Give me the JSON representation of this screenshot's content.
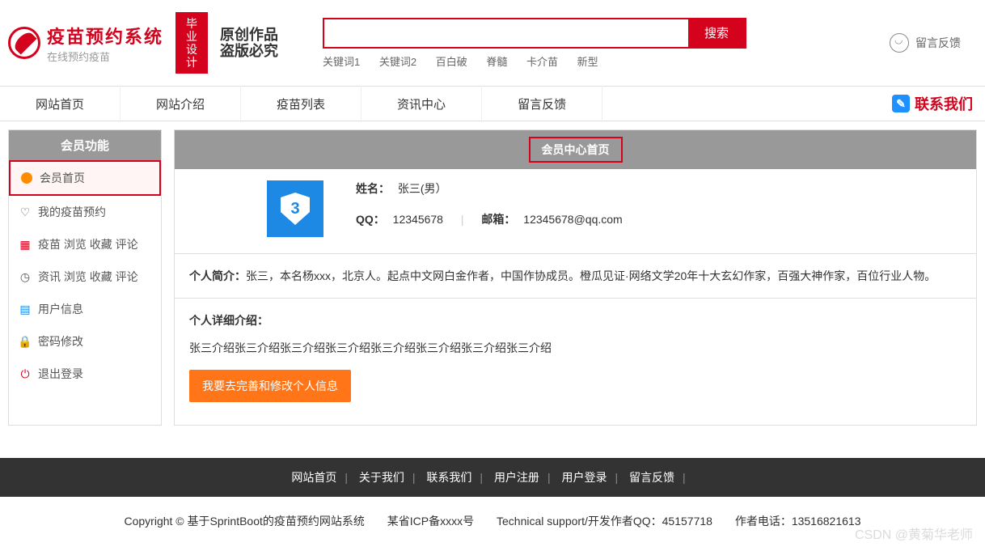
{
  "header": {
    "site_title": "疫苗预约系统",
    "site_subtitle": "在线预约疫苗",
    "badge": "毕业\n设计",
    "art_text": "原创作品\n盗版必究",
    "search_btn": "搜索",
    "keywords": [
      "关键词1",
      "关键词2",
      "百白破",
      "脊髓",
      "卡介苗",
      "新型"
    ],
    "feedback": "留言反馈"
  },
  "nav": {
    "items": [
      "网站首页",
      "网站介绍",
      "疫苗列表",
      "资讯中心",
      "留言反馈"
    ],
    "contact": "联系我们"
  },
  "sidebar": {
    "title": "会员功能",
    "items": [
      {
        "label": "会员首页",
        "active": true
      },
      {
        "label": "我的疫苗预约"
      },
      {
        "label": "疫苗 浏览 收藏 评论"
      },
      {
        "label": "资讯 浏览 收藏 评论"
      },
      {
        "label": "用户信息"
      },
      {
        "label": "密码修改"
      },
      {
        "label": "退出登录"
      }
    ]
  },
  "content": {
    "title": "会员中心首页",
    "name_label": "姓名：",
    "name_value": "张三(男）",
    "qq_label": "QQ：",
    "qq_value": "12345678",
    "email_label": "邮箱：",
    "email_value": "12345678@qq.com",
    "intro_label": "个人简介：",
    "intro_text": "张三，本名杨xxx，北京人。起点中文网白金作者，中国作协成员。橙瓜见证·网络文学20年十大玄幻作家，百强大神作家，百位行业人物。",
    "detail_label": "个人详细介绍：",
    "detail_text": "张三介绍张三介绍张三介绍张三介绍张三介绍张三介绍张三介绍张三介绍",
    "edit_btn": "我要去完善和修改个人信息"
  },
  "footer": {
    "nav": [
      "网站首页",
      "关于我们",
      "联系我们",
      "用户注册",
      "用户登录",
      "留言反馈"
    ],
    "copyright": "Copyright © 基于SprintBoot的疫苗预约网站系统",
    "icp": "某省ICP备xxxx号",
    "support": "Technical support/开发作者QQ：45157718",
    "phone": "作者电话：13516821613"
  },
  "watermark": "CSDN @黄菊华老师"
}
